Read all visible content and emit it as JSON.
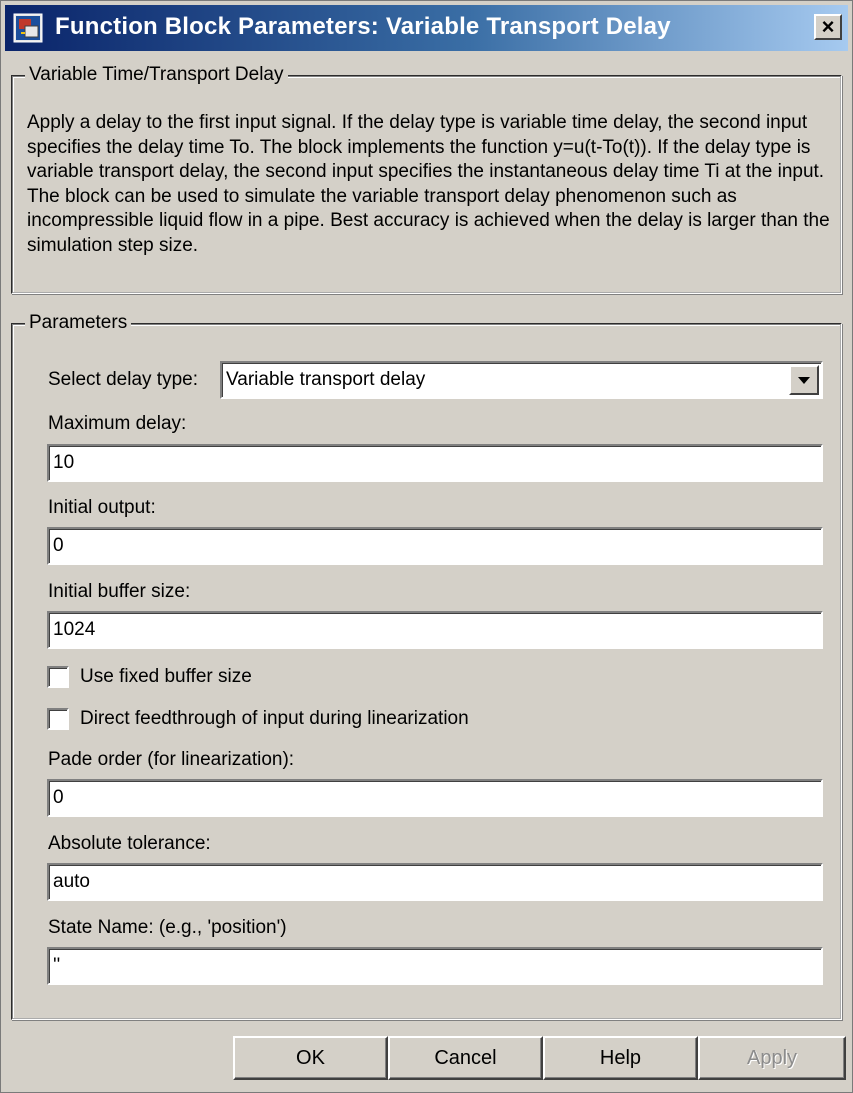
{
  "window": {
    "title": "Function Block Parameters: Variable Transport Delay",
    "close_label": "×",
    "title_icon": "simulink-block-icon"
  },
  "description_group": {
    "legend": "Variable Time/Transport Delay",
    "text": "Apply a delay to the first input signal.  If the delay type is variable time delay, the second input specifies the delay time To. The block implements the function y=u(t-To(t)). If the delay type is variable transport delay, the second input specifies the instantaneous delay time Ti at the input. The block can be used to simulate the variable transport delay phenomenon such as incompressible liquid flow in a pipe. Best accuracy is achieved when the delay is larger than the simulation step size."
  },
  "parameters": {
    "legend": "Parameters",
    "delay_type_label": "Select delay type:",
    "delay_type_value": "Variable transport delay",
    "max_delay_label": "Maximum delay:",
    "max_delay_value": "10",
    "initial_output_label": "Initial output:",
    "initial_output_value": "0",
    "buffer_size_label": "Initial buffer size:",
    "buffer_size_value": "1024",
    "fixed_buffer_label": "Use fixed buffer size",
    "fixed_buffer_checked": false,
    "direct_feedthrough_label": "Direct feedthrough of input during linearization",
    "direct_feedthrough_checked": false,
    "pade_order_label": "Pade order (for linearization):",
    "pade_order_value": "0",
    "abs_tol_label": "Absolute tolerance:",
    "abs_tol_value": "auto",
    "state_name_label": "State Name: (e.g., 'position')",
    "state_name_value": "''"
  },
  "buttons": {
    "ok": "OK",
    "cancel": "Cancel",
    "help": "Help",
    "apply": "Apply"
  },
  "colors": {
    "dialog_bg": "#d4d0c8",
    "title_gradient_start": "#0a246a",
    "title_gradient_end": "#a6caf0"
  }
}
